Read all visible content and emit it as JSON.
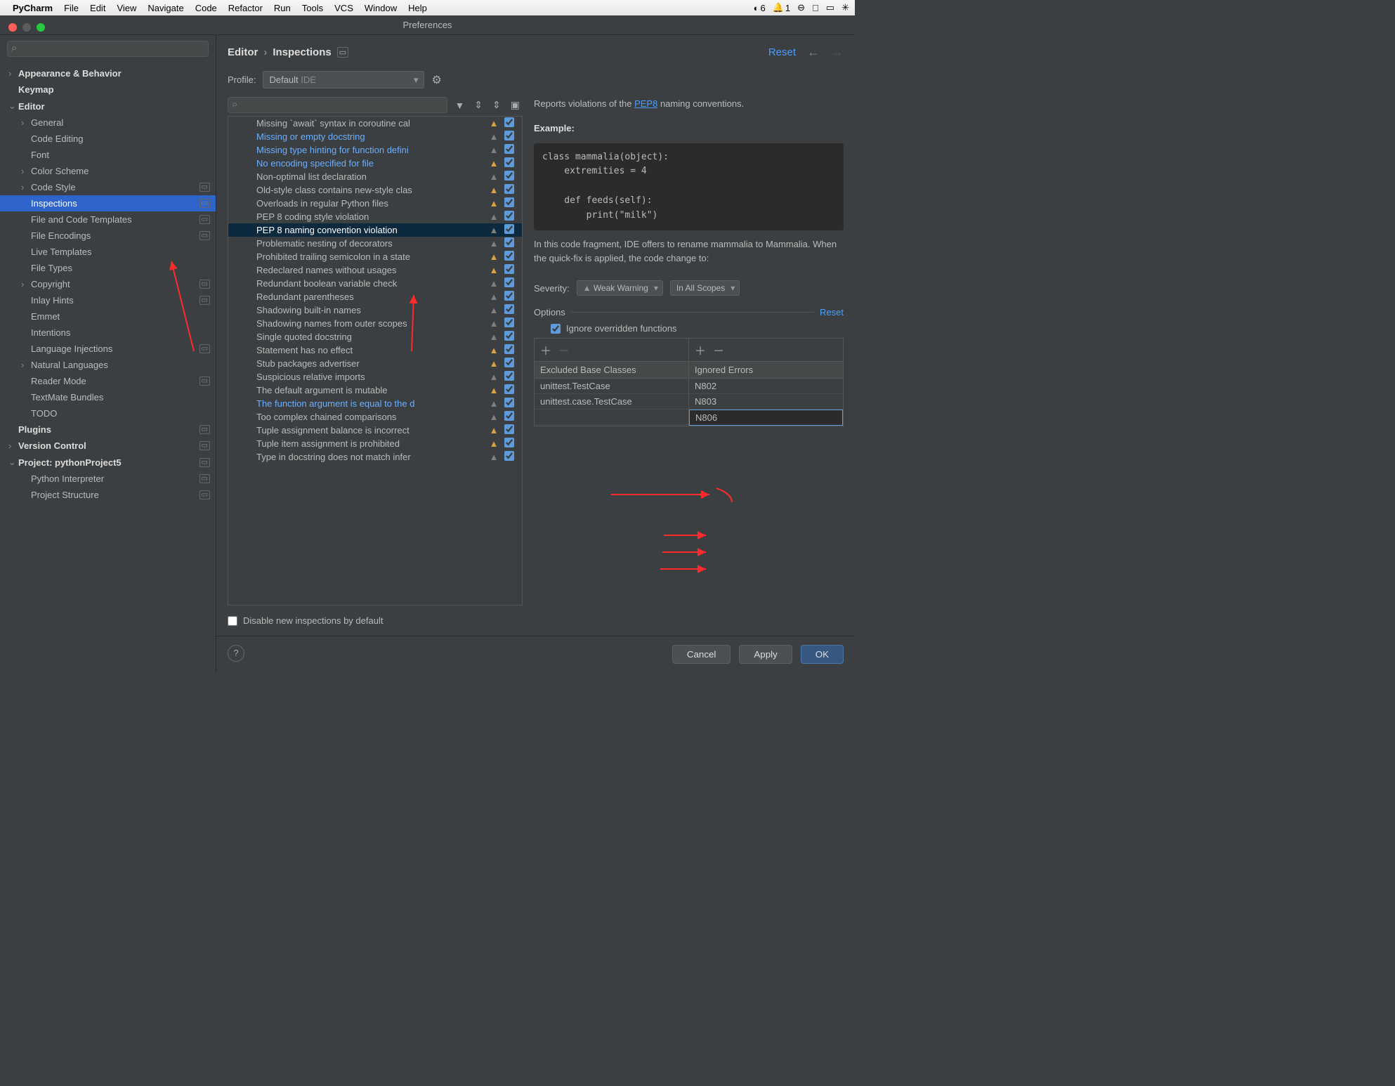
{
  "menubar": {
    "app": "PyCharm",
    "items": [
      "File",
      "Edit",
      "View",
      "Navigate",
      "Code",
      "Refactor",
      "Run",
      "Tools",
      "VCS",
      "Window",
      "Help"
    ],
    "right": {
      "globe": "6",
      "bell": "1"
    }
  },
  "window_title": "Preferences",
  "sidebar": {
    "search_placeholder": "",
    "rows": [
      {
        "label": "Appearance & Behavior",
        "bold": true,
        "chev": "›",
        "indent": 0
      },
      {
        "label": "Keymap",
        "bold": true,
        "indent": 0
      },
      {
        "label": "Editor",
        "bold": true,
        "chev": "⌄",
        "indent": 0
      },
      {
        "label": "General",
        "chev": "›",
        "indent": 1
      },
      {
        "label": "Code Editing",
        "indent": 1
      },
      {
        "label": "Font",
        "indent": 1
      },
      {
        "label": "Color Scheme",
        "chev": "›",
        "indent": 1
      },
      {
        "label": "Code Style",
        "chev": "›",
        "indent": 1,
        "mini": true
      },
      {
        "label": "Inspections",
        "indent": 1,
        "selected": true,
        "mini": true
      },
      {
        "label": "File and Code Templates",
        "indent": 1,
        "mini": true
      },
      {
        "label": "File Encodings",
        "indent": 1,
        "mini": true
      },
      {
        "label": "Live Templates",
        "indent": 1
      },
      {
        "label": "File Types",
        "indent": 1
      },
      {
        "label": "Copyright",
        "chev": "›",
        "indent": 1,
        "mini": true
      },
      {
        "label": "Inlay Hints",
        "indent": 1,
        "mini": true
      },
      {
        "label": "Emmet",
        "indent": 1
      },
      {
        "label": "Intentions",
        "indent": 1
      },
      {
        "label": "Language Injections",
        "indent": 1,
        "mini": true
      },
      {
        "label": "Natural Languages",
        "chev": "›",
        "indent": 1
      },
      {
        "label": "Reader Mode",
        "indent": 1,
        "mini": true
      },
      {
        "label": "TextMate Bundles",
        "indent": 1
      },
      {
        "label": "TODO",
        "indent": 1
      },
      {
        "label": "Plugins",
        "bold": true,
        "indent": 0,
        "mini": true
      },
      {
        "label": "Version Control",
        "bold": true,
        "chev": "›",
        "indent": 0,
        "mini": true
      },
      {
        "label": "Project: pythonProject5",
        "bold": true,
        "chev": "⌄",
        "indent": 0,
        "mini": true
      },
      {
        "label": "Python Interpreter",
        "indent": 1,
        "mini": true
      },
      {
        "label": "Project Structure",
        "indent": 1,
        "mini": true
      }
    ]
  },
  "crumbs": {
    "a": "Editor",
    "b": "Inspections",
    "reset": "Reset"
  },
  "profile": {
    "label": "Profile:",
    "value": "Default",
    "suffix": "IDE"
  },
  "inspections": [
    {
      "text": "Missing `await` syntax in coroutine cal",
      "warn": "y",
      "on": true
    },
    {
      "text": "Missing or empty docstring",
      "blue": true,
      "warn": "g",
      "on": true
    },
    {
      "text": "Missing type hinting for function defini",
      "blue": true,
      "warn": "g",
      "on": true
    },
    {
      "text": "No encoding specified for file",
      "blue": true,
      "warn": "y",
      "on": true
    },
    {
      "text": "Non-optimal list declaration",
      "warn": "g",
      "on": true
    },
    {
      "text": "Old-style class contains new-style clas",
      "warn": "y",
      "on": true
    },
    {
      "text": "Overloads in regular Python files",
      "warn": "y",
      "on": true
    },
    {
      "text": "PEP 8 coding style violation",
      "warn": "g",
      "on": true
    },
    {
      "text": "PEP 8 naming convention violation",
      "warn": "g",
      "on": true,
      "sel": true
    },
    {
      "text": "Problematic nesting of decorators",
      "warn": "g",
      "on": true
    },
    {
      "text": "Prohibited trailing semicolon in a state",
      "warn": "y",
      "on": true
    },
    {
      "text": "Redeclared names without usages",
      "warn": "y",
      "on": true
    },
    {
      "text": "Redundant boolean variable check",
      "warn": "g",
      "on": true
    },
    {
      "text": "Redundant parentheses",
      "warn": "g",
      "on": true
    },
    {
      "text": "Shadowing built-in names",
      "warn": "g",
      "on": true
    },
    {
      "text": "Shadowing names from outer scopes",
      "warn": "g",
      "on": true
    },
    {
      "text": "Single quoted docstring",
      "warn": "g",
      "on": true
    },
    {
      "text": "Statement has no effect",
      "warn": "y",
      "on": true
    },
    {
      "text": "Stub packages advertiser",
      "warn": "y",
      "on": true
    },
    {
      "text": "Suspicious relative imports",
      "warn": "g",
      "on": true
    },
    {
      "text": "The default argument is mutable",
      "warn": "y",
      "on": true
    },
    {
      "text": "The function argument is equal to the d",
      "blue": true,
      "warn": "g",
      "on": true
    },
    {
      "text": "Too complex chained comparisons",
      "warn": "g",
      "on": true
    },
    {
      "text": "Tuple assignment balance is incorrect",
      "warn": "y",
      "on": true
    },
    {
      "text": "Tuple item assignment is prohibited",
      "warn": "y",
      "on": true
    },
    {
      "text": "Type in docstring does not match infer",
      "warn": "g",
      "on": true
    }
  ],
  "desc": {
    "reports": "Reports violations of the ",
    "link": "PEP8",
    "reports2": " naming conventions.",
    "example": "Example:",
    "code": "class mammalia(object):\n    extremities = 4\n\n    def feeds(self):\n        print(\"milk\")",
    "after": "In this code fragment, IDE offers to rename mammalia to Mammalia. When the quick-fix is applied, the code change to:"
  },
  "severity": {
    "label": "Severity:",
    "val": "Weak Warning",
    "scope": "In All Scopes"
  },
  "options": {
    "head": "Options",
    "reset": "Reset",
    "ignore": "Ignore overridden functions",
    "excluded_head": "Excluded Base Classes",
    "excluded": [
      "unittest.TestCase",
      "unittest.case.TestCase"
    ],
    "ignored_head": "Ignored Errors",
    "ignored": [
      "N802",
      "N803",
      "N806"
    ]
  },
  "disable_label": "Disable new inspections by default",
  "buttons": {
    "cancel": "Cancel",
    "apply": "Apply",
    "ok": "OK"
  }
}
